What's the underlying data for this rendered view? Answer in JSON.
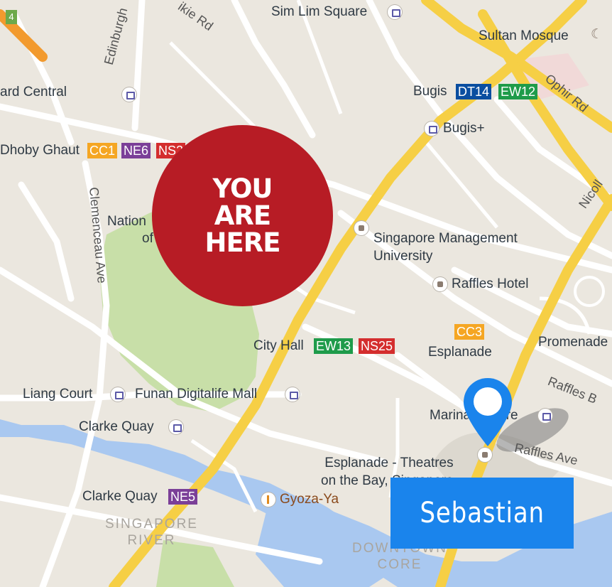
{
  "map": {
    "colors": {
      "background": "#ebe7df",
      "major_road": "#f6cf45",
      "minor_road": "#ffffff",
      "park": "#c8dfa8",
      "water": "#a9c8f0"
    },
    "corner_badge": "4",
    "places": [
      {
        "id": "sim-lim-square",
        "label": "Sim Lim Square",
        "icon": "shopping-bag-icon"
      },
      {
        "id": "sultan-mosque",
        "label": "Sultan Mosque",
        "icon": "crescent-icon"
      },
      {
        "id": "bugis",
        "label": "Bugis",
        "icon": ""
      },
      {
        "id": "bugis-plus",
        "label": "Bugis+",
        "icon": "shopping-bag-icon"
      },
      {
        "id": "ard-central",
        "label": "ard Central",
        "icon": "shopping-bag-icon"
      },
      {
        "id": "dhoby-ghaut",
        "label": "Dhoby Ghaut",
        "icon": ""
      },
      {
        "id": "nation",
        "label": "Nation",
        "icon": ""
      },
      {
        "id": "of",
        "label": "of",
        "icon": ""
      },
      {
        "id": "smu",
        "label": "Singapore Management\nUniversity",
        "icon": "graduation-cap-icon"
      },
      {
        "id": "raffles-hotel",
        "label": "Raffles Hotel",
        "icon": "hotel-icon"
      },
      {
        "id": "city-hall",
        "label": "City Hall",
        "icon": ""
      },
      {
        "id": "esplanade",
        "label": "Esplanade",
        "icon": ""
      },
      {
        "id": "promenade",
        "label": "Promenade",
        "icon": ""
      },
      {
        "id": "liang-court",
        "label": "Liang Court",
        "icon": "shopping-bag-icon"
      },
      {
        "id": "funan",
        "label": "Funan Digitalife Mall",
        "icon": "shopping-bag-icon"
      },
      {
        "id": "clarke-quay",
        "label": "Clarke Quay",
        "icon": "shopping-bag-icon"
      },
      {
        "id": "marina-square",
        "label": "Marina Square",
        "icon": "shopping-bag-icon"
      },
      {
        "id": "esplanade-theatres",
        "label": "Esplanade - Theatres\non the Bay, Singapore",
        "icon": "theatre-icon"
      },
      {
        "id": "clarke-quay-mrt",
        "label": "Clarke Quay",
        "icon": ""
      },
      {
        "id": "gyoza-ya",
        "label": "Gyoza-Ya",
        "icon": "fork-knife-icon"
      }
    ],
    "streets": [
      {
        "id": "kirk-rd",
        "label": "ikie Rd"
      },
      {
        "id": "edinburgh",
        "label": "Edinburgh"
      },
      {
        "id": "ophir-rd",
        "label": "Ophir Rd"
      },
      {
        "id": "nicoll",
        "label": "Nicoll"
      },
      {
        "id": "clemenceau",
        "label": "Clemenceau Ave"
      },
      {
        "id": "raffles-blvd",
        "label": "Raffles B"
      },
      {
        "id": "raffles-ave",
        "label": "Raffles Ave"
      }
    ],
    "areas": [
      {
        "id": "singapore-river",
        "label": "SINGAPORE\nRIVER"
      },
      {
        "id": "downtown-core",
        "label": "DOWNTOWN\nCORE"
      }
    ],
    "station_codes": [
      {
        "id": "dt14",
        "label": "DT14",
        "color": "#0a4ea0"
      },
      {
        "id": "ew12",
        "label": "EW12",
        "color": "#1e9b4a"
      },
      {
        "id": "cc1",
        "label": "CC1",
        "color": "#f5a623"
      },
      {
        "id": "ne6",
        "label": "NE6",
        "color": "#7b3f98"
      },
      {
        "id": "ns2",
        "label": "NS2",
        "color": "#d42e2e"
      },
      {
        "id": "ew13",
        "label": "EW13",
        "color": "#1e9b4a"
      },
      {
        "id": "ns25",
        "label": "NS25",
        "color": "#d42e2e"
      },
      {
        "id": "cc3",
        "label": "CC3",
        "color": "#f5a623"
      },
      {
        "id": "ne5",
        "label": "NE5",
        "color": "#7b3f98"
      }
    ],
    "overlay": {
      "you_are_here": "YOU\nARE\nHERE",
      "you_are_here_color": "#b71c25",
      "name_banner": "Sebastian",
      "name_banner_color": "#1a84ec",
      "pin_color": "#1a84ec"
    }
  }
}
